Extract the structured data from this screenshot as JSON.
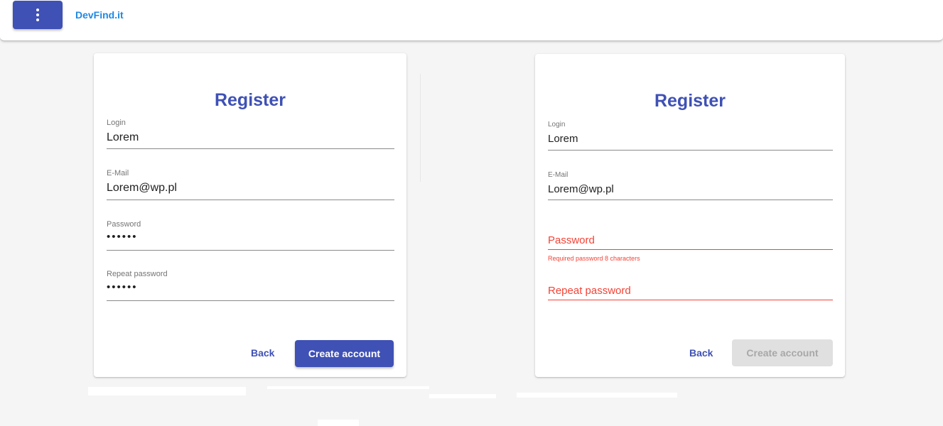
{
  "app": {
    "brand": "DevFind.it",
    "menu_icon": "more-vert-icon"
  },
  "colors": {
    "primary": "#3f51b5",
    "link": "#1e88e5",
    "error": "#f44336",
    "disabled_bg": "#e0e0e0"
  },
  "left_form": {
    "title": "Register",
    "login": {
      "label": "Login",
      "value": "Lorem"
    },
    "email": {
      "label": "E-Mail",
      "value": "Lorem@wp.pl"
    },
    "password": {
      "label": "Password",
      "value": "••••••"
    },
    "repeat_password": {
      "label": "Repeat password",
      "value": "••••••"
    },
    "back_label": "Back",
    "create_label": "Create account"
  },
  "right_form": {
    "title": "Register",
    "login": {
      "label": "Login",
      "value": "Lorem"
    },
    "email": {
      "label": "E-Mail",
      "value": "Lorem@wp.pl"
    },
    "password": {
      "label": "Password",
      "error": "Required password 8 characters"
    },
    "repeat_password": {
      "label": "Repeat password"
    },
    "back_label": "Back",
    "create_label": "Create account"
  }
}
